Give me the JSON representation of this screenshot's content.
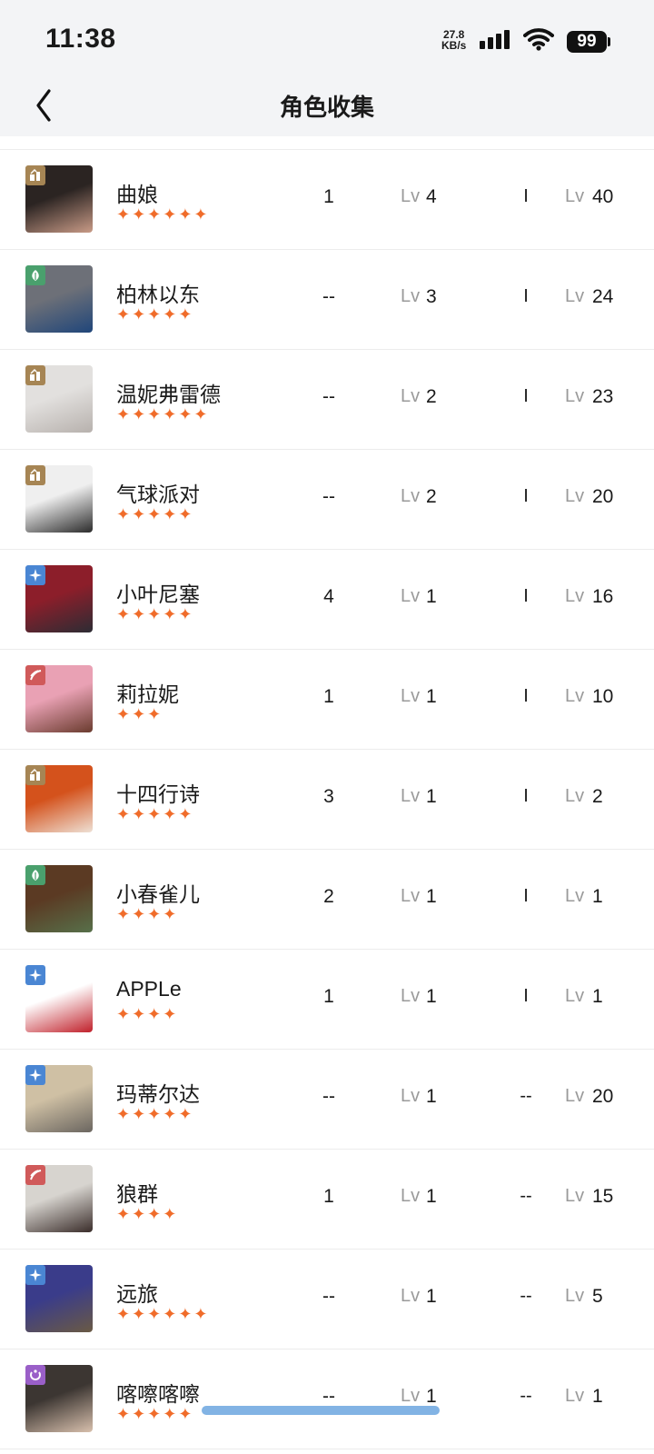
{
  "status": {
    "time": "11:38",
    "speed_value": "27.8",
    "speed_unit": "KB/s",
    "battery": "99"
  },
  "header": {
    "title": "角色收集"
  },
  "colors": {
    "star": "#f06c2a",
    "badge_gold": "#a68554",
    "badge_green": "#4aa06d",
    "badge_blue": "#4a86d3",
    "badge_red": "#d05a5a",
    "badge_purple": "#9a5fc8"
  },
  "lv_prefix": "Lv",
  "characters": [
    {
      "name": "曲娘",
      "stars": "✦✦✦✦✦✦",
      "count": "1",
      "lv_a": "4",
      "mid": "I",
      "lv_b": "40",
      "badge": "gold",
      "avatar": [
        "#2b2422",
        "#c99b87"
      ]
    },
    {
      "name": "柏林以东",
      "stars": "✦✦✦✦✦",
      "count": "--",
      "lv_a": "3",
      "mid": "I",
      "lv_b": "24",
      "badge": "green",
      "avatar": [
        "#6d7078",
        "#20467a"
      ]
    },
    {
      "name": "温妮弗雷德",
      "stars": "✦✦✦✦✦✦",
      "count": "--",
      "lv_a": "2",
      "mid": "I",
      "lv_b": "23",
      "badge": "gold",
      "avatar": [
        "#e2e0de",
        "#b7b1ad"
      ]
    },
    {
      "name": "气球派对",
      "stars": "✦✦✦✦✦",
      "count": "--",
      "lv_a": "2",
      "mid": "I",
      "lv_b": "20",
      "badge": "gold",
      "avatar": [
        "#efefef",
        "#2b2b2b"
      ]
    },
    {
      "name": "小叶尼塞",
      "stars": "✦✦✦✦✦",
      "count": "4",
      "lv_a": "1",
      "mid": "I",
      "lv_b": "16",
      "badge": "blue",
      "avatar": [
        "#8c1e2a",
        "#2c2c34"
      ]
    },
    {
      "name": "莉拉妮",
      "stars": "✦✦✦",
      "count": "1",
      "lv_a": "1",
      "mid": "I",
      "lv_b": "10",
      "badge": "red",
      "avatar": [
        "#e9a1b4",
        "#6a3b2e"
      ]
    },
    {
      "name": "十四行诗",
      "stars": "✦✦✦✦✦",
      "count": "3",
      "lv_a": "1",
      "mid": "I",
      "lv_b": "2",
      "badge": "gold",
      "avatar": [
        "#d4521c",
        "#eee0d4"
      ]
    },
    {
      "name": "小春雀儿",
      "stars": "✦✦✦✦",
      "count": "2",
      "lv_a": "1",
      "mid": "I",
      "lv_b": "1",
      "badge": "green",
      "avatar": [
        "#5b3a23",
        "#57704a"
      ]
    },
    {
      "name": "APPLe",
      "stars": "✦✦✦✦",
      "count": "1",
      "lv_a": "1",
      "mid": "I",
      "lv_b": "1",
      "badge": "blue",
      "avatar": [
        "#ffffff",
        "#c0202a"
      ]
    },
    {
      "name": "玛蒂尔达",
      "stars": "✦✦✦✦✦",
      "count": "--",
      "lv_a": "1",
      "mid": "--",
      "lv_b": "20",
      "badge": "blue",
      "avatar": [
        "#cfc0a4",
        "#6b6660"
      ]
    },
    {
      "name": "狼群",
      "stars": "✦✦✦✦",
      "count": "1",
      "lv_a": "1",
      "mid": "--",
      "lv_b": "15",
      "badge": "red",
      "avatar": [
        "#d7d4cf",
        "#3a2d2a"
      ]
    },
    {
      "name": "远旅",
      "stars": "✦✦✦✦✦✦",
      "count": "--",
      "lv_a": "1",
      "mid": "--",
      "lv_b": "5",
      "badge": "blue",
      "avatar": [
        "#3a3c8a",
        "#6a5a44"
      ]
    },
    {
      "name": "喀嚓喀嚓",
      "stars": "✦✦✦✦✦",
      "count": "--",
      "lv_a": "1",
      "mid": "--",
      "lv_b": "1",
      "badge": "purple",
      "avatar": [
        "#3c3632",
        "#d8c0ad"
      ]
    }
  ]
}
